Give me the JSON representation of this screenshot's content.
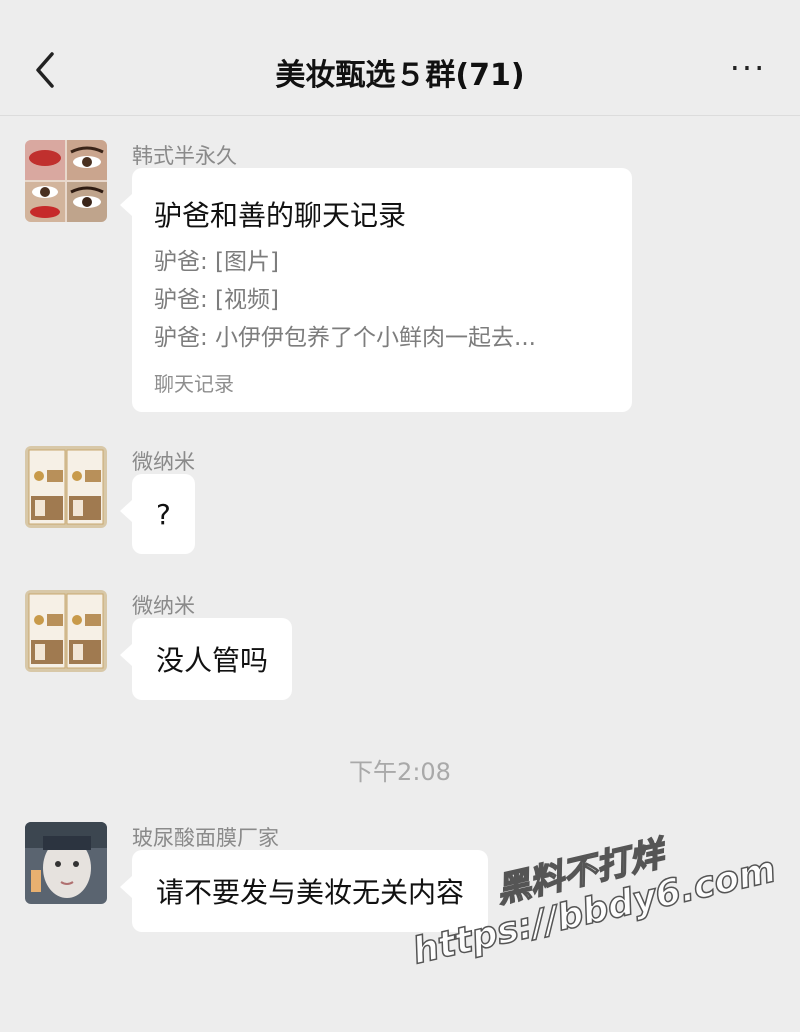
{
  "header": {
    "title": "美妆甄选５群(71)",
    "more_label": "···"
  },
  "messages": [
    {
      "sender": "韩式半永久",
      "type": "chat_record",
      "record": {
        "title": "驴爸和善的聊天记录",
        "lines": [
          "驴爸: [图片]",
          "驴爸: [视频]",
          "驴爸: 小伊伊包养了个小鲜肉一起去..."
        ],
        "footer": "聊天记录"
      }
    },
    {
      "sender": "微纳米",
      "type": "text",
      "text": "?"
    },
    {
      "sender": "微纳米",
      "type": "text",
      "text": "没人管吗"
    },
    {
      "sender": "玻尿酸面膜厂家",
      "type": "text",
      "text": "请不要发与美妆无关内容"
    }
  ],
  "timestamp": "下午2:08",
  "watermark": {
    "line1": "黑料不打烊",
    "line2": "https://bbdy6.com"
  }
}
